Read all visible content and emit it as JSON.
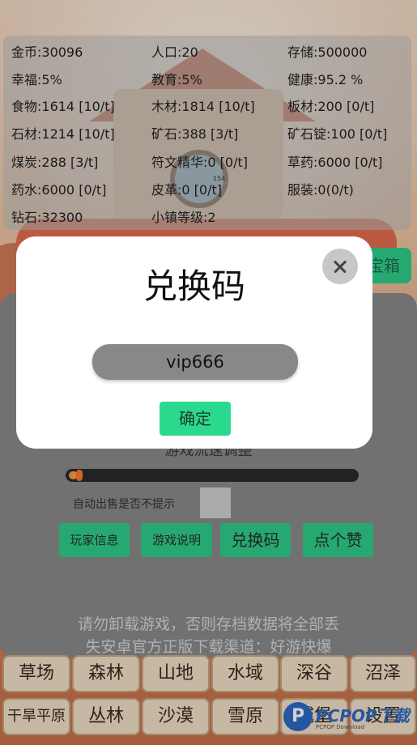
{
  "stats": [
    {
      "text": "金币:30096"
    },
    {
      "text": "人口:20"
    },
    {
      "text": "存储:500000"
    },
    {
      "text": "幸福:5%"
    },
    {
      "text": "教育:5%"
    },
    {
      "text": "健康:95.2 %"
    },
    {
      "text": "食物:1614 [10/t]"
    },
    {
      "text": "木材:1814 [10/t]"
    },
    {
      "text": "板材:200 [0/t]"
    },
    {
      "text": "石材:1214 [10/t]"
    },
    {
      "text": "矿石:388 [3/t]"
    },
    {
      "text": "矿石锭:100 [0/t]"
    },
    {
      "text": "煤炭:288 [3/t]"
    },
    {
      "text": "符文精华:0 [0/t]"
    },
    {
      "text": "草药:6000 [0/t]"
    },
    {
      "text": "药水:6000 [0/t]"
    },
    {
      "text": "皮革:0 [0/t]"
    },
    {
      "text": "服装:0(0/t)"
    },
    {
      "text": "钻石:32300"
    },
    {
      "text": "小镇等级:2"
    }
  ],
  "tiny_label": "154",
  "chest_button": "宝箱",
  "modal": {
    "title": "兑换码",
    "code_value": "vip666",
    "confirm": "确定"
  },
  "speed_label": "游戏流速调整",
  "speed_level": 0.03,
  "auto_sell_label": "自动出售是否不提示",
  "buttons": {
    "player_info": "玩家信息",
    "game_guide": "游戏说明",
    "redeem": "兑换码",
    "like": "点个赞"
  },
  "warning": {
    "line1": "请勿卸载游戏，否则存档数据将全部丢",
    "line2": "失安卓官方正版下载渠道：好游快爆"
  },
  "regions_row1": [
    "草场",
    "森林",
    "山地",
    "水域",
    "深谷",
    "沼泽"
  ],
  "regions_row2": [
    "干旱平原",
    "丛林",
    "沙漠",
    "雪原",
    "城堡",
    "设置"
  ],
  "watermark": {
    "text": "PCPOP下载",
    "sub": "PCPOP Download"
  }
}
